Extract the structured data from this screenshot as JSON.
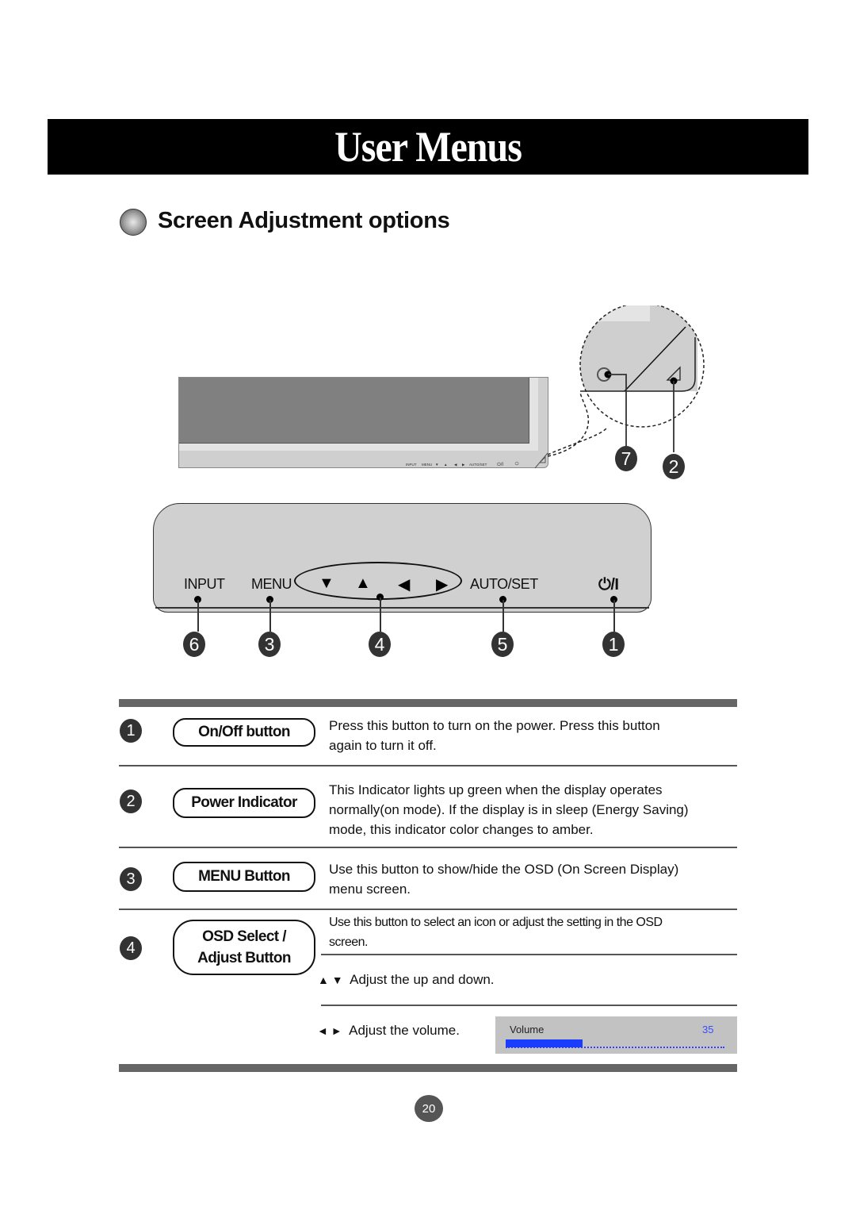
{
  "page": {
    "title": "User Menus",
    "section_title": "Screen Adjustment options",
    "page_number": "20"
  },
  "monitor_diagram": {
    "tiny_labels": [
      "INPUT",
      "MENU",
      "▼",
      "▲",
      "◀",
      "▶",
      "AUTO/SET",
      "⏻/I",
      "○",
      "◿"
    ],
    "callouts": [
      "7",
      "2"
    ]
  },
  "front_panel": {
    "buttons": [
      {
        "label": "INPUT",
        "callout": "6"
      },
      {
        "label": "MENU",
        "callout": "3"
      },
      {
        "arrows": [
          "▼",
          "▲",
          "◀",
          "▶"
        ],
        "callout": "4"
      },
      {
        "label": "AUTO/SET",
        "callout": "5"
      },
      {
        "label": "⏻/I",
        "callout": "1"
      }
    ]
  },
  "table": {
    "rows": [
      {
        "num": "1",
        "name": "On/Off button",
        "desc": [
          "Press this button to turn on the power. Press this button",
          "again to turn it off."
        ]
      },
      {
        "num": "2",
        "name": "Power Indicator",
        "desc": [
          "This Indicator lights up green when the display operates",
          "normally(on mode). If the display is in sleep (Energy Saving)",
          "mode, this indicator color changes to amber."
        ]
      },
      {
        "num": "3",
        "name": "MENU Button",
        "desc": [
          "Use this button to show/hide the OSD (On Screen Display)",
          "menu screen."
        ]
      },
      {
        "num": "4",
        "name_lines": [
          "OSD Select /",
          "Adjust Button"
        ],
        "desc": [
          "Use this button to select an icon or adjust the setting in the OSD",
          "screen."
        ],
        "sub": [
          {
            "icons": "▲ ▼",
            "text": "Adjust the up and down."
          },
          {
            "icons": "◄ ►",
            "text": "Adjust the volume."
          }
        ]
      }
    ]
  },
  "volume_osd": {
    "label": "Volume",
    "value": "35",
    "level_fraction": 0.35,
    "fill_color": "#1a3cff",
    "value_color": "#3b4dff"
  }
}
